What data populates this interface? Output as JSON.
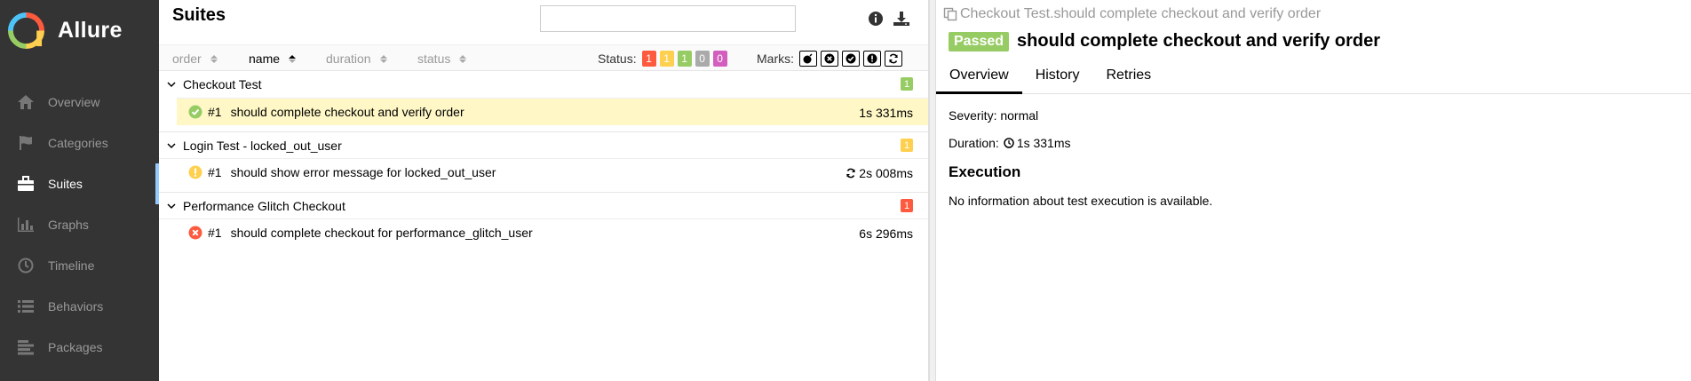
{
  "sidebar": {
    "brand": "Allure",
    "items": [
      {
        "label": "Overview",
        "icon": "home-icon"
      },
      {
        "label": "Categories",
        "icon": "flag-icon"
      },
      {
        "label": "Suites",
        "icon": "briefcase-icon",
        "active": true
      },
      {
        "label": "Graphs",
        "icon": "bar-chart-icon"
      },
      {
        "label": "Timeline",
        "icon": "clock-icon"
      },
      {
        "label": "Behaviors",
        "icon": "list-icon"
      },
      {
        "label": "Packages",
        "icon": "align-left-icon"
      }
    ]
  },
  "suites": {
    "title": "Suites",
    "search_placeholder": "",
    "sort": {
      "order": "order",
      "name": "name",
      "duration": "duration",
      "status": "status",
      "active": "name"
    },
    "status_label": "Status:",
    "status_counts": [
      {
        "value": "1",
        "color": "#fd5a3e"
      },
      {
        "value": "1",
        "color": "#ffd050"
      },
      {
        "value": "1",
        "color": "#97cc64"
      },
      {
        "value": "0",
        "color": "#aaaaaa"
      },
      {
        "value": "0",
        "color": "#d35ebe"
      }
    ],
    "marks_label": "Marks:",
    "groups": [
      {
        "name": "Checkout Test",
        "count": "1",
        "count_color": "#97cc64",
        "tests": [
          {
            "num": "#1",
            "name": "should complete checkout and verify order",
            "duration": "1s 331ms",
            "status": "passed",
            "selected": true,
            "retried": false
          }
        ]
      },
      {
        "name": "Login Test - locked_out_user",
        "count": "1",
        "count_color": "#ffd050",
        "tests": [
          {
            "num": "#1",
            "name": "should show error message for locked_out_user",
            "duration": "2s 008ms",
            "status": "broken",
            "selected": false,
            "retried": true
          }
        ]
      },
      {
        "name": "Performance Glitch Checkout",
        "count": "1",
        "count_color": "#fd5a3e",
        "tests": [
          {
            "num": "#1",
            "name": "should complete checkout for performance_glitch_user",
            "duration": "6s 296ms",
            "status": "failed",
            "selected": false,
            "retried": false
          }
        ]
      }
    ]
  },
  "details": {
    "breadcrumb": "Checkout Test.should complete checkout and verify order",
    "status_badge": "Passed",
    "title": "should complete checkout and verify order",
    "tabs": [
      "Overview",
      "History",
      "Retries"
    ],
    "severity": "Severity: normal",
    "duration_label": "Duration:",
    "duration_value": "1s 331ms",
    "execution_heading": "Execution",
    "execution_text": "No information about test execution is available."
  },
  "colors": {
    "passed": "#97cc64",
    "broken": "#ffd050",
    "failed": "#fd5a3e",
    "skipped": "#aaaaaa",
    "unknown": "#d35ebe",
    "sidebar_bg": "#343434",
    "active_accent": "#97cbff"
  }
}
